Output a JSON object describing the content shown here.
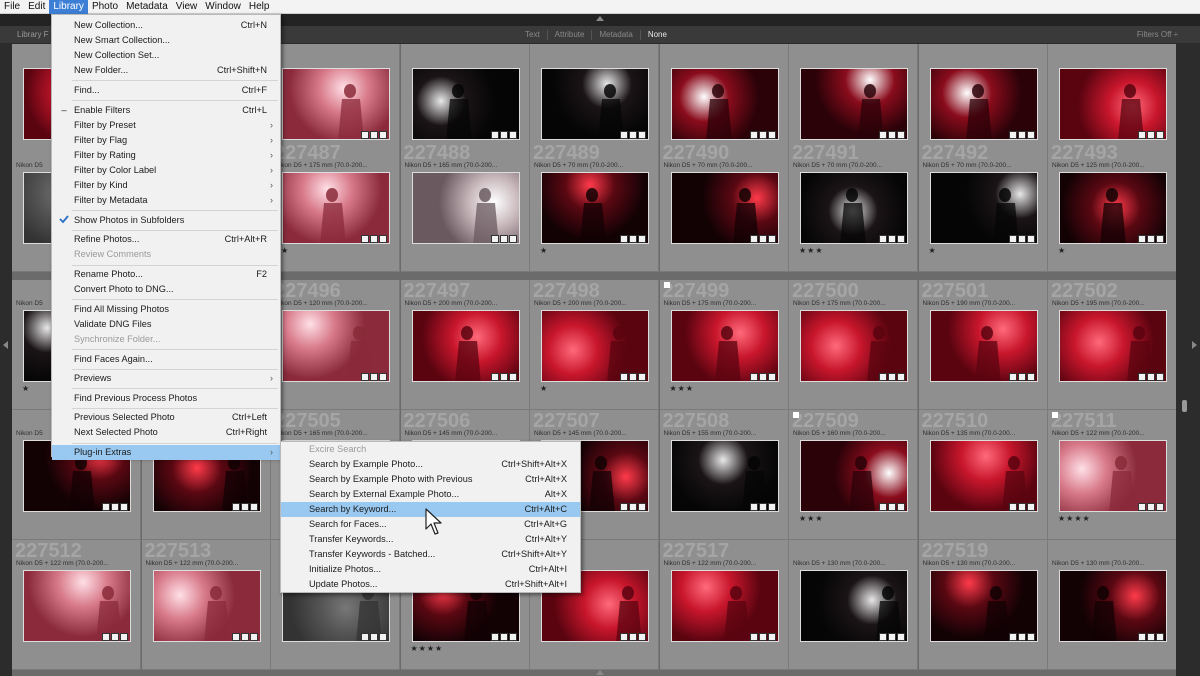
{
  "menubar": {
    "items": [
      "File",
      "Edit",
      "Library",
      "Photo",
      "Metadata",
      "View",
      "Window",
      "Help"
    ],
    "active": "Library"
  },
  "filterbar": {
    "title": "Library F",
    "tabs": [
      "Text",
      "Attribute",
      "Metadata",
      "None"
    ],
    "selected_tab": "None",
    "filters_off": "Filters Off ÷"
  },
  "library_menu": [
    {
      "label": "New Collection...",
      "shortcut": "Ctrl+N"
    },
    {
      "label": "New Smart Collection...",
      "shortcut": ""
    },
    {
      "label": "New Collection Set...",
      "shortcut": ""
    },
    {
      "label": "New Folder...",
      "shortcut": "Ctrl+Shift+N"
    },
    {
      "sep": true
    },
    {
      "label": "Find...",
      "shortcut": "Ctrl+F"
    },
    {
      "sep": true
    },
    {
      "label": "Enable Filters",
      "shortcut": "Ctrl+L",
      "mark": "–"
    },
    {
      "label": "Filter by Preset",
      "submenu": true
    },
    {
      "label": "Filter by Flag",
      "submenu": true
    },
    {
      "label": "Filter by Rating",
      "submenu": true
    },
    {
      "label": "Filter by Color Label",
      "submenu": true
    },
    {
      "label": "Filter by Kind",
      "submenu": true
    },
    {
      "label": "Filter by Metadata",
      "submenu": true
    },
    {
      "sep": true
    },
    {
      "label": "Show Photos in Subfolders",
      "check": true
    },
    {
      "sep": true
    },
    {
      "label": "Refine Photos...",
      "shortcut": "Ctrl+Alt+R"
    },
    {
      "label": "Review Comments",
      "disabled": true
    },
    {
      "sep": true
    },
    {
      "label": "Rename Photo...",
      "shortcut": "F2"
    },
    {
      "label": "Convert Photo to DNG..."
    },
    {
      "sep": true
    },
    {
      "label": "Find All Missing Photos"
    },
    {
      "label": "Validate DNG Files"
    },
    {
      "label": "Synchronize Folder...",
      "disabled": true
    },
    {
      "sep": true
    },
    {
      "label": "Find Faces Again..."
    },
    {
      "sep": true
    },
    {
      "label": "Previews",
      "submenu": true
    },
    {
      "sep": true
    },
    {
      "label": "Find Previous Process Photos"
    },
    {
      "sep": true
    },
    {
      "label": "Previous Selected Photo",
      "shortcut": "Ctrl+Left"
    },
    {
      "label": "Next Selected Photo",
      "shortcut": "Ctrl+Right"
    },
    {
      "sep": true
    },
    {
      "label": "Plug-in Extras",
      "submenu": true,
      "highlight": true
    }
  ],
  "plugin_submenu": [
    {
      "label": "Excire Search",
      "disabled": true
    },
    {
      "label": "Search by Example Photo...",
      "shortcut": "Ctrl+Shift+Alt+X"
    },
    {
      "label": "Search by Example Photo with Previous",
      "shortcut": "Ctrl+Alt+X"
    },
    {
      "label": "Search by External Example Photo...",
      "shortcut": "Alt+X"
    },
    {
      "label": "Search by Keyword...",
      "shortcut": "Ctrl+Alt+C",
      "highlight": true
    },
    {
      "label": "Search for Faces...",
      "shortcut": "Ctrl+Alt+G"
    },
    {
      "label": "Transfer Keywords...",
      "shortcut": "Ctrl+Alt+Y"
    },
    {
      "label": "Transfer Keywords - Batched...",
      "shortcut": "Ctrl+Shift+Alt+Y"
    },
    {
      "label": "Initialize Photos...",
      "shortcut": "Ctrl+Alt+I"
    },
    {
      "label": "Update Photos...",
      "shortcut": "Ctrl+Shift+Alt+I"
    }
  ],
  "grid": {
    "rows": [
      {
        "cells": [
          {
            "num": "",
            "meta": "",
            "palette": "red",
            "stars": ""
          },
          {
            "num": "",
            "meta": "",
            "palette": "hidden",
            "stars": ""
          },
          {
            "num": "",
            "meta": "",
            "palette": "pinkfog",
            "stars": ""
          },
          {
            "num": "",
            "meta": "",
            "palette": "dark",
            "stars": ""
          },
          {
            "num": "",
            "meta": "",
            "palette": "dark",
            "stars": ""
          },
          {
            "num": "",
            "meta": "",
            "palette": "redwhite",
            "stars": "★★★"
          },
          {
            "num": "",
            "meta": "",
            "palette": "redwhite",
            "stars": ""
          },
          {
            "num": "",
            "meta": "",
            "palette": "redwhite",
            "stars": ""
          },
          {
            "num": "",
            "meta": "",
            "palette": "red",
            "stars": "★★★"
          }
        ]
      },
      {
        "cells": [
          {
            "num": "",
            "meta": "Nikon D5",
            "palette": "hidden",
            "stars": ""
          },
          {
            "num": "",
            "meta": "",
            "palette": "hidden",
            "stars": ""
          },
          {
            "num": "227487",
            "meta": "Nikon D5 + 175 mm (70.0-200...",
            "palette": "pinkfog",
            "stars": "★"
          },
          {
            "num": "227488",
            "meta": "Nikon D5 + 165 mm (70.0-200...",
            "palette": "fog",
            "stars": ""
          },
          {
            "num": "227489",
            "meta": "Nikon D5 + 70 mm (70.0-200...",
            "palette": "darkred",
            "stars": "★"
          },
          {
            "num": "227490",
            "meta": "Nikon D5 + 70 mm (70.0-200...",
            "palette": "darkred",
            "stars": ""
          },
          {
            "num": "227491",
            "meta": "Nikon D5 + 70 mm (70.0-200...",
            "palette": "dark",
            "stars": "★★★"
          },
          {
            "num": "227492",
            "meta": "Nikon D5 + 70 mm (70.0-200...",
            "palette": "dark",
            "stars": "★"
          },
          {
            "num": "227493",
            "meta": "Nikon D5 + 125 mm (70.0-200...",
            "palette": "darkred",
            "stars": "★"
          }
        ]
      },
      {
        "cells": [
          {
            "num": "",
            "meta": "Nikon D5",
            "palette": "dark",
            "stars": "★"
          },
          {
            "num": "",
            "meta": "",
            "palette": "hidden",
            "stars": ""
          },
          {
            "num": "227496",
            "meta": "Nikon D5 + 120 mm (70.0-200...",
            "palette": "pinkfog",
            "stars": ""
          },
          {
            "num": "227497",
            "meta": "Nikon D5 + 200 mm (70.0-200...",
            "palette": "red",
            "stars": ""
          },
          {
            "num": "227498",
            "meta": "Nikon D5 + 200 mm (70.0-200...",
            "palette": "red",
            "stars": "★"
          },
          {
            "num": "227499",
            "meta": "Nikon D5 + 175 mm (70.0-200...",
            "palette": "red",
            "stars": "★★★",
            "flag": true
          },
          {
            "num": "227500",
            "meta": "Nikon D5 + 175 mm (70.0-200...",
            "palette": "red",
            "stars": ""
          },
          {
            "num": "227501",
            "meta": "Nikon D5 + 190 mm (70.0-200...",
            "palette": "red",
            "stars": ""
          },
          {
            "num": "227502",
            "meta": "Nikon D5 + 195 mm (70.0-200...",
            "palette": "red",
            "stars": ""
          }
        ]
      },
      {
        "cells": [
          {
            "num": "",
            "meta": "Nikon D5",
            "palette": "darkred",
            "stars": ""
          },
          {
            "num": "",
            "meta": "",
            "palette": "darkred",
            "stars": ""
          },
          {
            "num": "227505",
            "meta": "Nikon D5 + 165 mm (70.0-200...",
            "palette": "hidden",
            "stars": ""
          },
          {
            "num": "227506",
            "meta": "Nikon D5 + 145 mm (70.0-200...",
            "palette": "hidden",
            "stars": ""
          },
          {
            "num": "227507",
            "meta": "Nikon D5 + 145 mm (70.0-200...",
            "palette": "darkred",
            "stars": ""
          },
          {
            "num": "227508",
            "meta": "Nikon D5 + 155 mm (70.0-200...",
            "palette": "dark",
            "stars": ""
          },
          {
            "num": "227509",
            "meta": "Nikon D5 + 160 mm (70.0-200...",
            "palette": "redwhite",
            "stars": "★★★",
            "flag": true
          },
          {
            "num": "227510",
            "meta": "Nikon D5 + 135 mm (70.0-200...",
            "palette": "red",
            "stars": ""
          },
          {
            "num": "227511",
            "meta": "Nikon D5 + 122 mm (70.0-200...",
            "palette": "pinkfog",
            "stars": "★★★★",
            "flag": true
          }
        ]
      },
      {
        "cells": [
          {
            "num": "227512",
            "meta": "Nikon D5 + 122 mm (70.0-200...",
            "palette": "pinkfog",
            "stars": ""
          },
          {
            "num": "227513",
            "meta": "Nikon D5 + 122 mm (70.0-200...",
            "palette": "pinkfog",
            "stars": ""
          },
          {
            "num": "",
            "meta": "",
            "palette": "hidden",
            "stars": ""
          },
          {
            "num": "",
            "meta": "",
            "palette": "darkred",
            "stars": "★★★★"
          },
          {
            "num": "",
            "meta": "",
            "palette": "red",
            "stars": ""
          },
          {
            "num": "227517",
            "meta": "Nikon D5 + 122 mm (70.0-200...",
            "palette": "red",
            "stars": ""
          },
          {
            "num": "",
            "meta": "Nikon D5 + 130 mm (70.0-200...",
            "palette": "dark",
            "stars": ""
          },
          {
            "num": "227519",
            "meta": "Nikon D5 + 130 mm (70.0-200...",
            "palette": "darkred",
            "stars": ""
          },
          {
            "num": "",
            "meta": "Nikon D5 + 130 mm (70.0-200...",
            "palette": "darkred",
            "stars": ""
          }
        ]
      }
    ]
  },
  "colors": {
    "accent": "#3d7fd6",
    "menu_highlight": "#99c9f0"
  }
}
